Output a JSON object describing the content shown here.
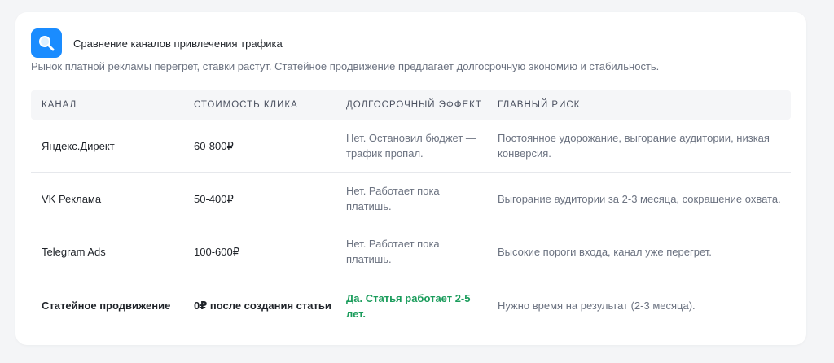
{
  "header": {
    "title": "Сравнение каналов привлечения трафика",
    "subtitle": "Рынок платной рекламы перегрет, ставки растут. Статейное продвижение предлагает долгосрочную экономию и стабильность.",
    "icon": "search-icon"
  },
  "colors": {
    "accent": "#1a8cff",
    "highlight_green": "#1a9c5b"
  },
  "table": {
    "columns": [
      "Канал",
      "Стоимость клика",
      "Долгосрочный эффект",
      "Главный риск"
    ],
    "rows": [
      {
        "channel": "Яндекс.Директ",
        "cost": "60-800₽",
        "effect": "Нет. Остановил бюджет — трафик пропал.",
        "risk": "Постоянное удорожание, выгорание аудитории, низкая конверсия."
      },
      {
        "channel": "VK Реклама",
        "cost": "50-400₽",
        "effect": "Нет. Работает пока платишь.",
        "risk": "Выгорание аудитории за 2-3 месяца, сокращение охвата."
      },
      {
        "channel": "Telegram Ads",
        "cost": "100-600₽",
        "effect": "Нет. Работает пока платишь.",
        "risk": "Высокие пороги входа, канал уже перегрет."
      },
      {
        "channel": "Статейное продвижение",
        "cost": "0₽ после создания статьи",
        "effect": "Да. Статья работает 2-5 лет.",
        "risk": "Нужно время на результат (2-3 месяца)."
      }
    ]
  }
}
